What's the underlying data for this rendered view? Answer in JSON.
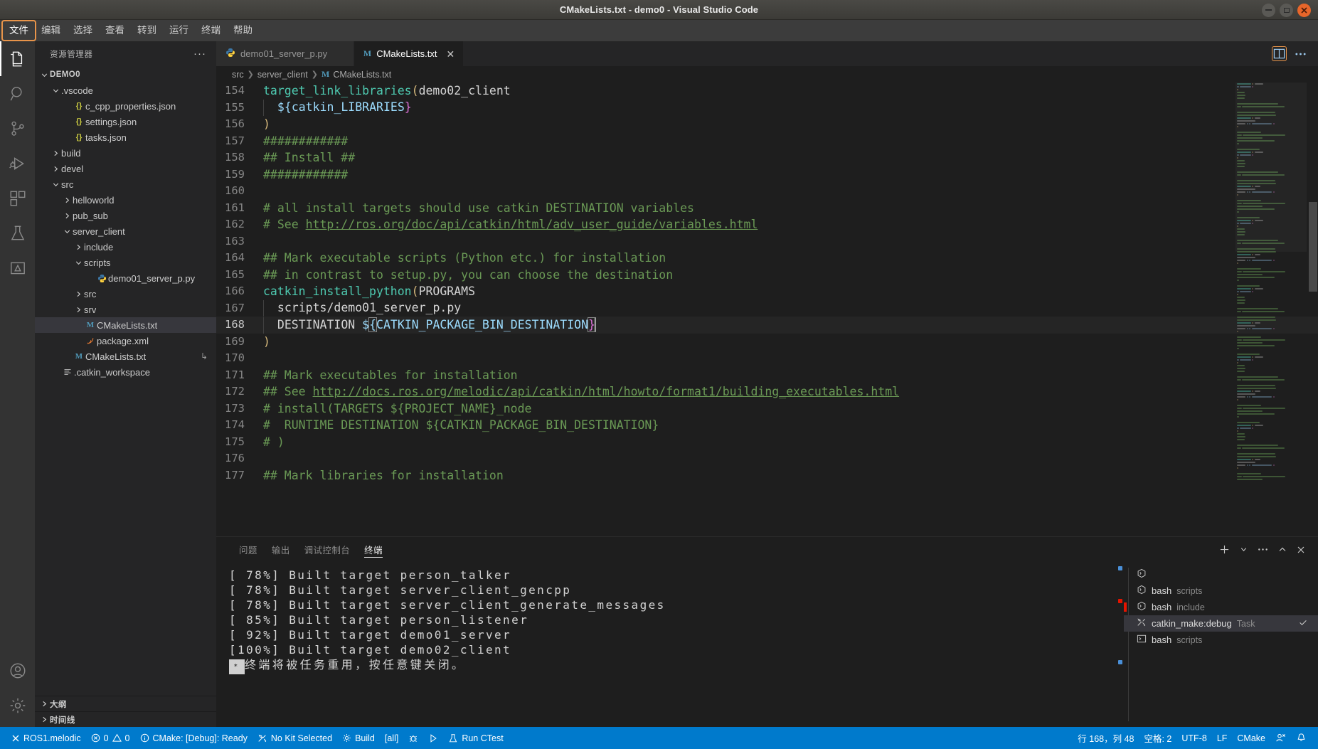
{
  "window": {
    "title": "CMakeLists.txt - demo0 - Visual Studio Code",
    "controls": {
      "minimize": "minimize",
      "maximize": "maximize",
      "close": "close"
    }
  },
  "menubar": {
    "items": [
      {
        "label": "文件",
        "focused": true
      },
      {
        "label": "编辑",
        "focused": false
      },
      {
        "label": "选择",
        "focused": false
      },
      {
        "label": "查看",
        "focused": false
      },
      {
        "label": "转到",
        "focused": false
      },
      {
        "label": "运行",
        "focused": false
      },
      {
        "label": "终端",
        "focused": false
      },
      {
        "label": "帮助",
        "focused": false
      }
    ]
  },
  "activitybar": {
    "items": [
      {
        "name": "explorer-icon",
        "active": true
      },
      {
        "name": "search-icon",
        "active": false
      },
      {
        "name": "source-control-icon",
        "active": false
      },
      {
        "name": "run-and-debug-icon",
        "active": false
      },
      {
        "name": "extensions-icon",
        "active": false
      },
      {
        "name": "testing-icon",
        "active": false
      },
      {
        "name": "cmake-icon",
        "active": false
      }
    ],
    "bottom": [
      {
        "name": "accounts-icon"
      },
      {
        "name": "manage-gear-icon"
      }
    ]
  },
  "sidebar": {
    "title": "资源管理器",
    "more_label": "···",
    "tree": [
      {
        "label": "DEMO0",
        "indent": 0,
        "chevron": "down",
        "icon": "",
        "bold": true,
        "selected": false
      },
      {
        "label": ".vscode",
        "indent": 1,
        "chevron": "down",
        "icon": "",
        "bold": false,
        "selected": false
      },
      {
        "label": "c_cpp_properties.json",
        "indent": 2,
        "chevron": "none",
        "icon": "json",
        "bold": false,
        "selected": false
      },
      {
        "label": "settings.json",
        "indent": 2,
        "chevron": "none",
        "icon": "json",
        "bold": false,
        "selected": false
      },
      {
        "label": "tasks.json",
        "indent": 2,
        "chevron": "none",
        "icon": "json",
        "bold": false,
        "selected": false
      },
      {
        "label": "build",
        "indent": 1,
        "chevron": "right",
        "icon": "",
        "bold": false,
        "selected": false
      },
      {
        "label": "devel",
        "indent": 1,
        "chevron": "right",
        "icon": "",
        "bold": false,
        "selected": false
      },
      {
        "label": "src",
        "indent": 1,
        "chevron": "down",
        "icon": "",
        "bold": false,
        "selected": false
      },
      {
        "label": "helloworld",
        "indent": 2,
        "chevron": "right",
        "icon": "",
        "bold": false,
        "selected": false
      },
      {
        "label": "pub_sub",
        "indent": 2,
        "chevron": "right",
        "icon": "",
        "bold": false,
        "selected": false
      },
      {
        "label": "server_client",
        "indent": 2,
        "chevron": "down",
        "icon": "",
        "bold": false,
        "selected": false
      },
      {
        "label": "include",
        "indent": 3,
        "chevron": "right",
        "icon": "",
        "bold": false,
        "selected": false
      },
      {
        "label": "scripts",
        "indent": 3,
        "chevron": "down",
        "icon": "",
        "bold": false,
        "selected": false
      },
      {
        "label": "demo01_server_p.py",
        "indent": 4,
        "chevron": "none",
        "icon": "py",
        "bold": false,
        "selected": false
      },
      {
        "label": "src",
        "indent": 3,
        "chevron": "right",
        "icon": "",
        "bold": false,
        "selected": false
      },
      {
        "label": "srv",
        "indent": 3,
        "chevron": "right",
        "icon": "",
        "bold": false,
        "selected": false
      },
      {
        "label": "CMakeLists.txt",
        "indent": 3,
        "chevron": "none",
        "icon": "cmake",
        "bold": false,
        "selected": true
      },
      {
        "label": "package.xml",
        "indent": 3,
        "chevron": "none",
        "icon": "xml",
        "bold": false,
        "selected": false
      },
      {
        "label": "CMakeLists.txt",
        "indent": 2,
        "chevron": "none",
        "icon": "cmake",
        "bold": false,
        "selected": false,
        "trail": "↳"
      },
      {
        "label": ".catkin_workspace",
        "indent": 1,
        "chevron": "none",
        "icon": "lines",
        "bold": false,
        "selected": false
      }
    ],
    "sections": [
      {
        "label": "大纲"
      },
      {
        "label": "时间线"
      }
    ]
  },
  "editor": {
    "tabs": [
      {
        "label": "demo01_server_p.py",
        "icon": "py",
        "active": false
      },
      {
        "label": "CMakeLists.txt",
        "icon": "cmake",
        "active": true
      }
    ],
    "tab_actions": [
      {
        "name": "split-editor-icon",
        "focused": true
      },
      {
        "name": "more-actions-icon",
        "focused": false
      }
    ],
    "breadcrumb": [
      "src",
      "server_client",
      "CMakeLists.txt"
    ],
    "first_line_number": 154,
    "lines": [
      {
        "n": 154,
        "segs": [
          {
            "t": "target_link_libraries",
            "c": "fn"
          },
          {
            "t": "(",
            "c": "paren"
          },
          {
            "t": "demo02_client",
            "c": "plain"
          }
        ]
      },
      {
        "n": 155,
        "guide": true,
        "segs": [
          {
            "t": " ${",
            "c": "varname"
          },
          {
            "t": "catkin_LIBRARIES",
            "c": "varname"
          },
          {
            "t": "}",
            "c": "brace-pink"
          }
        ]
      },
      {
        "n": 156,
        "segs": [
          {
            "t": ")",
            "c": "paren"
          }
        ]
      },
      {
        "n": 157,
        "segs": [
          {
            "t": "############",
            "c": "comment"
          }
        ]
      },
      {
        "n": 158,
        "segs": [
          {
            "t": "## Install ##",
            "c": "comment"
          }
        ]
      },
      {
        "n": 159,
        "segs": [
          {
            "t": "############",
            "c": "comment"
          }
        ]
      },
      {
        "n": 160,
        "segs": []
      },
      {
        "n": 161,
        "segs": [
          {
            "t": "# all install targets should use catkin DESTINATION variables",
            "c": "comment"
          }
        ]
      },
      {
        "n": 162,
        "segs": [
          {
            "t": "# See ",
            "c": "comment"
          },
          {
            "t": "http://ros.org/doc/api/catkin/html/adv_user_guide/variables.html",
            "c": "link"
          }
        ]
      },
      {
        "n": 163,
        "segs": []
      },
      {
        "n": 164,
        "segs": [
          {
            "t": "## Mark executable scripts (Python etc.) for installation",
            "c": "comment"
          }
        ]
      },
      {
        "n": 165,
        "segs": [
          {
            "t": "## in contrast to setup.py, you can choose the destination",
            "c": "comment"
          }
        ]
      },
      {
        "n": 166,
        "segs": [
          {
            "t": "catkin_install_python",
            "c": "fn"
          },
          {
            "t": "(",
            "c": "paren"
          },
          {
            "t": "PROGRAMS",
            "c": "plain"
          }
        ]
      },
      {
        "n": 167,
        "guide": true,
        "segs": [
          {
            "t": " scripts/demo01_server_p.py",
            "c": "plain"
          }
        ]
      },
      {
        "n": 168,
        "guide": true,
        "current": true,
        "segs": [
          {
            "t": " DESTINATION ",
            "c": "plain"
          },
          {
            "t": "$",
            "c": "varname"
          },
          {
            "t": "{",
            "c": "varname",
            "box": true
          },
          {
            "t": "CATKIN_PACKAGE_BIN_DESTINATION",
            "c": "varname"
          },
          {
            "t": "}",
            "c": "brace-pink",
            "box": true
          }
        ],
        "cursor": true
      },
      {
        "n": 169,
        "segs": [
          {
            "t": ")",
            "c": "paren"
          }
        ]
      },
      {
        "n": 170,
        "segs": []
      },
      {
        "n": 171,
        "segs": [
          {
            "t": "## Mark executables for installation",
            "c": "comment"
          }
        ]
      },
      {
        "n": 172,
        "segs": [
          {
            "t": "## See ",
            "c": "comment"
          },
          {
            "t": "http://docs.ros.org/melodic/api/catkin/html/howto/format1/building_executables.html",
            "c": "link"
          }
        ]
      },
      {
        "n": 173,
        "segs": [
          {
            "t": "# install(TARGETS ${PROJECT_NAME}_node",
            "c": "comment"
          }
        ]
      },
      {
        "n": 174,
        "segs": [
          {
            "t": "#  RUNTIME DESTINATION ${CATKIN_PACKAGE_BIN_DESTINATION}",
            "c": "comment"
          }
        ]
      },
      {
        "n": 175,
        "segs": [
          {
            "t": "# )",
            "c": "comment"
          }
        ]
      },
      {
        "n": 176,
        "segs": []
      },
      {
        "n": 177,
        "segs": [
          {
            "t": "## Mark libraries for installation",
            "c": "comment"
          }
        ]
      }
    ]
  },
  "panel": {
    "tabs": [
      {
        "label": "问题",
        "active": false
      },
      {
        "label": "输出",
        "active": false
      },
      {
        "label": "调试控制台",
        "active": false
      },
      {
        "label": "终端",
        "active": true
      }
    ],
    "actions": [
      {
        "name": "new-terminal-plus-icon"
      },
      {
        "name": "chevron-down-icon"
      },
      {
        "name": "more-actions-icon"
      },
      {
        "name": "maximize-panel-icon"
      },
      {
        "name": "close-panel-icon"
      }
    ],
    "terminal_output": [
      "[ 78%] Built target person_talker",
      "[ 78%] Built target server_client_gencpp",
      "[ 78%] Built target server_client_generate_messages",
      "[ 85%] Built target person_listener",
      "[ 92%] Built target demo01_server",
      "[100%] Built target demo02_client"
    ],
    "terminal_last_line": {
      "cursor_char": "*",
      "text": "终端将被任务重用，按任意键关闭。"
    },
    "terminal_list": [
      {
        "name": "",
        "desc": "",
        "icon": "terminal-bash-icon",
        "selected": false,
        "error": false,
        "check": false
      },
      {
        "name": "bash",
        "desc": "scripts",
        "icon": "terminal-bash-icon",
        "selected": false,
        "error": false,
        "check": false
      },
      {
        "name": "bash",
        "desc": "include",
        "icon": "terminal-bash-icon",
        "selected": false,
        "error": true,
        "check": false
      },
      {
        "name": "catkin_make:debug",
        "desc": "Task",
        "icon": "task-tools-icon",
        "selected": true,
        "error": false,
        "check": true
      },
      {
        "name": "bash",
        "desc": "scripts",
        "icon": "terminal-prompt-icon",
        "selected": false,
        "error": false,
        "check": false
      }
    ]
  },
  "statusbar": {
    "left": [
      {
        "name": "ros-status",
        "icon": "close-x-icon",
        "label": "ROS1.melodic"
      },
      {
        "name": "problems-status",
        "icon": "error-warning-icon",
        "label": "0  0"
      },
      {
        "name": "cmake-status",
        "icon": "info-icon",
        "label": "CMake: [Debug]: Ready"
      },
      {
        "name": "kit-status",
        "icon": "tools-icon",
        "label": "No Kit Selected"
      },
      {
        "name": "build-status",
        "icon": "gear-icon",
        "label": "Build"
      },
      {
        "name": "target-status",
        "icon": "",
        "label": "[all]"
      },
      {
        "name": "debug-status",
        "icon": "bug-icon",
        "label": ""
      },
      {
        "name": "launch-status",
        "icon": "play-icon",
        "label": ""
      },
      {
        "name": "ctest-status",
        "icon": "beaker-icon",
        "label": "Run CTest"
      }
    ],
    "right": [
      {
        "name": "cursor-position",
        "label": "行 168，列 48"
      },
      {
        "name": "indentation",
        "label": "空格: 2"
      },
      {
        "name": "encoding",
        "label": "UTF-8"
      },
      {
        "name": "eol",
        "label": "LF"
      },
      {
        "name": "language-mode",
        "label": "CMake"
      },
      {
        "name": "feedback-icon",
        "label": ""
      },
      {
        "name": "notifications-bell-icon",
        "label": ""
      }
    ]
  },
  "colors": {
    "accent": "#007acc",
    "focus_orange": "#e8944a",
    "comment_green": "#6a9955",
    "variable_blue": "#9cdcfe"
  }
}
